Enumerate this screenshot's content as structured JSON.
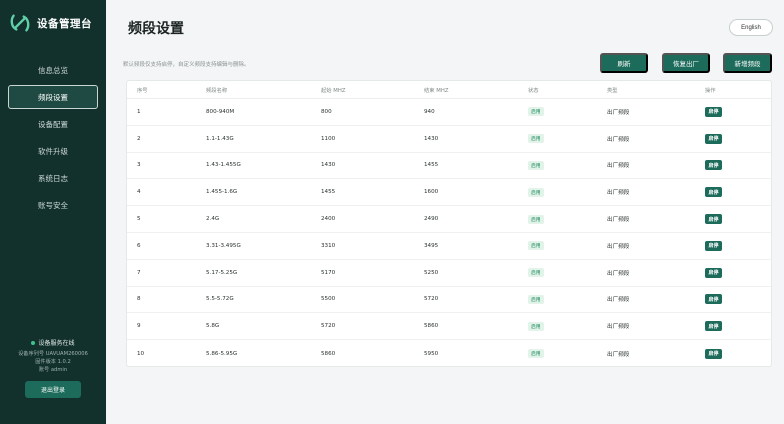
{
  "sidebar": {
    "brand_title": "设备管理台",
    "items": [
      {
        "label": "信息总览",
        "active": false
      },
      {
        "label": "频段设置",
        "active": true
      },
      {
        "label": "设备配置",
        "active": false
      },
      {
        "label": "软件升级",
        "active": false
      },
      {
        "label": "系统日志",
        "active": false
      },
      {
        "label": "账号安全",
        "active": false
      }
    ],
    "online_status": "设备服务在线",
    "serial": "设备序列号 UAVUAM260006",
    "firmware": "固件版本 1.0.2",
    "account": "账号 admin",
    "logout_label": "退出登录"
  },
  "header": {
    "title": "频段设置",
    "lang_label": "English"
  },
  "toolbar": {
    "description": "默认频段仅支持启停，自定义频段支持编辑与删除。",
    "refresh_label": "刷新",
    "reset_label": "恢复出厂",
    "add_label": "新增频段"
  },
  "table": {
    "headers": [
      "序号",
      "频段名称",
      "起始 MHZ",
      "结束 MHZ",
      "状态",
      "类型",
      "操作"
    ],
    "rows": [
      {
        "no": "1",
        "name": "800-940M",
        "start": "800",
        "end": "940",
        "status": "启用",
        "type": "出厂频段",
        "op": "启停"
      },
      {
        "no": "2",
        "name": "1.1-1.43G",
        "start": "1100",
        "end": "1430",
        "status": "启用",
        "type": "出厂频段",
        "op": "启停"
      },
      {
        "no": "3",
        "name": "1.43-1.455G",
        "start": "1430",
        "end": "1455",
        "status": "启用",
        "type": "出厂频段",
        "op": "启停"
      },
      {
        "no": "4",
        "name": "1.455-1.6G",
        "start": "1455",
        "end": "1600",
        "status": "启用",
        "type": "出厂频段",
        "op": "启停"
      },
      {
        "no": "5",
        "name": "2.4G",
        "start": "2400",
        "end": "2490",
        "status": "启用",
        "type": "出厂频段",
        "op": "启停"
      },
      {
        "no": "6",
        "name": "3.31-3.495G",
        "start": "3310",
        "end": "3495",
        "status": "启用",
        "type": "出厂频段",
        "op": "启停"
      },
      {
        "no": "7",
        "name": "5.17-5.25G",
        "start": "5170",
        "end": "5250",
        "status": "启用",
        "type": "出厂频段",
        "op": "启停"
      },
      {
        "no": "8",
        "name": "5.5-5.72G",
        "start": "5500",
        "end": "5720",
        "status": "启用",
        "type": "出厂频段",
        "op": "启停"
      },
      {
        "no": "9",
        "name": "5.8G",
        "start": "5720",
        "end": "5860",
        "status": "启用",
        "type": "出厂频段",
        "op": "启停"
      },
      {
        "no": "10",
        "name": "5.86-5.95G",
        "start": "5860",
        "end": "5950",
        "status": "启用",
        "type": "出厂频段",
        "op": "启停"
      }
    ]
  },
  "colors": {
    "sidebar_bg": "#12302c",
    "accent": "#1c6b5b",
    "status_green": "#1d8b5e"
  },
  "icons": {
    "logo": "brand-logo-icon",
    "online": "online-dot-icon"
  }
}
